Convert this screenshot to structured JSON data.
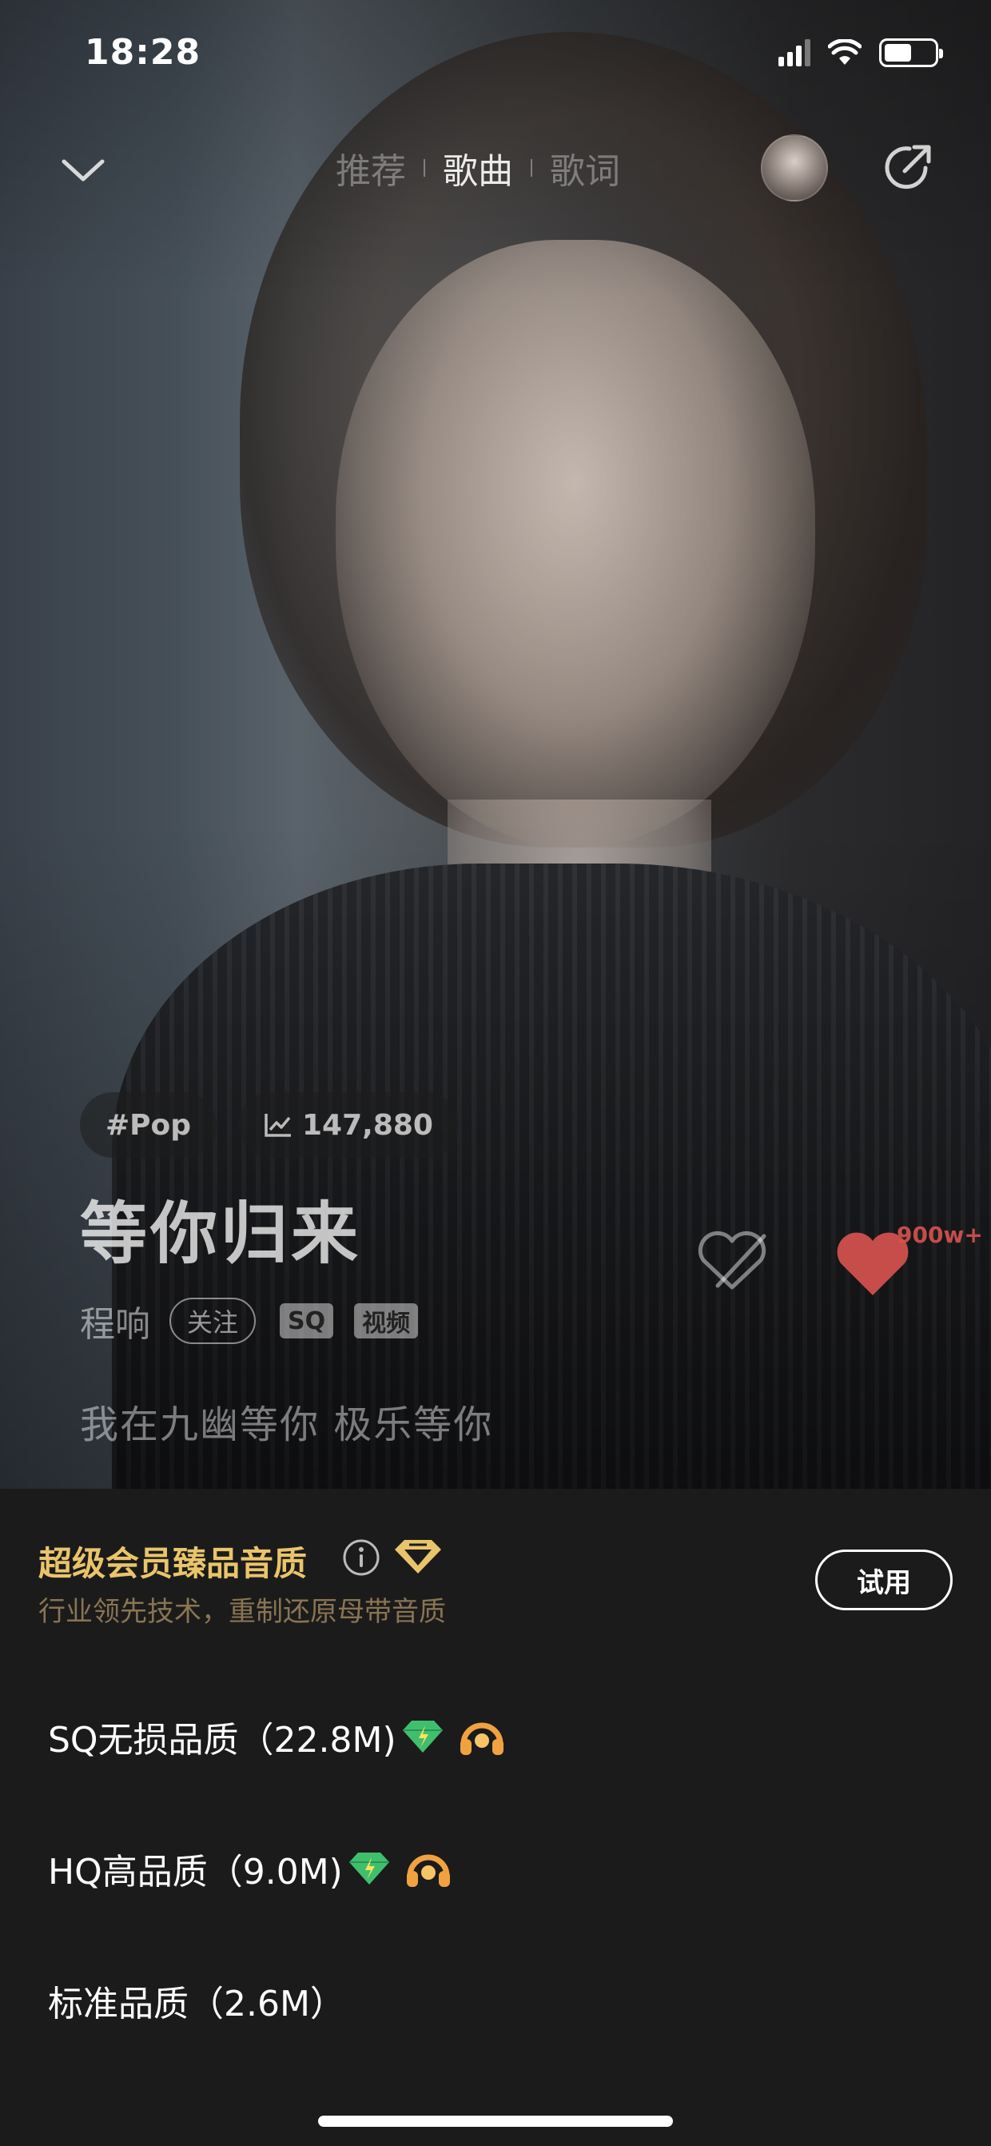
{
  "status_bar": {
    "time": "18:28"
  },
  "nav": {
    "tabs": [
      {
        "label": "推荐",
        "active": false
      },
      {
        "label": "歌曲",
        "active": true
      },
      {
        "label": "歌词",
        "active": false
      }
    ]
  },
  "song": {
    "genre_tag": "#Pop",
    "play_count": "147,880",
    "title": "等你归来",
    "artist": "程响",
    "follow_label": "关注",
    "badges": [
      "SQ",
      "视频"
    ],
    "lyric": "我在九幽等你 极乐等你",
    "like_count": "900w+"
  },
  "quality_sheet": {
    "vip_title": "超级会员臻品音质",
    "vip_subtitle": "行业领先技术，重制还原母带音质",
    "try_button": "试用",
    "options": [
      {
        "label": "SQ无损品质（22.8M)"
      },
      {
        "label": "HQ高品质（9.0M)"
      },
      {
        "label": "标准品质（2.6M）"
      }
    ]
  },
  "colors": {
    "vip_gold": "#e9c46a",
    "like_red": "#d9534f",
    "sheet_bg": "#1b1b1b"
  }
}
